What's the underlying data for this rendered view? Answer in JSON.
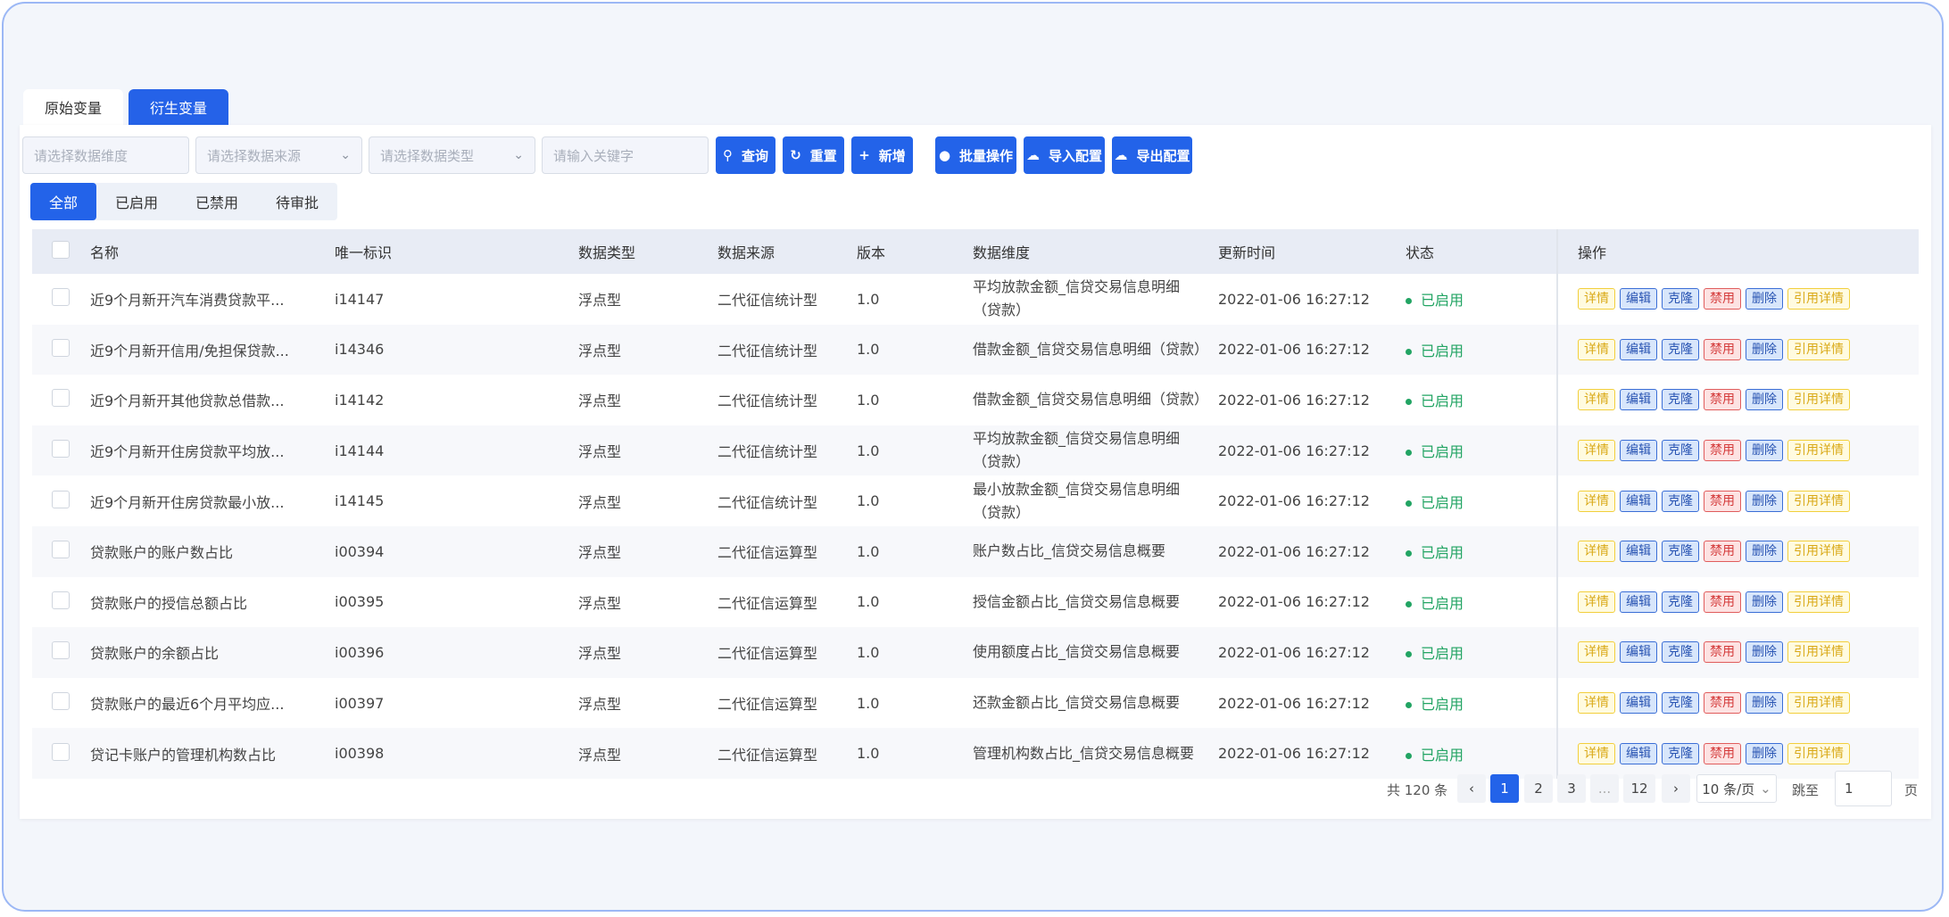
{
  "tabs": [
    {
      "label": "原始变量",
      "active": false
    },
    {
      "label": "衍生变量",
      "active": true
    }
  ],
  "filters": {
    "dimension_placeholder": "请选择数据维度",
    "source_placeholder": "请选择数据来源",
    "type_placeholder": "请选择数据类型",
    "keyword_placeholder": "请输入关键字"
  },
  "buttons": {
    "query": "查询",
    "reset": "重置",
    "add": "新增",
    "batch": "批量操作",
    "import": "导入配置",
    "export": "导出配置"
  },
  "status_tabs": [
    "全部",
    "已启用",
    "已禁用",
    "待审批"
  ],
  "table": {
    "headers": [
      "名称",
      "唯一标识",
      "数据类型",
      "数据来源",
      "版本",
      "数据维度",
      "更新时间",
      "状态",
      "操作"
    ],
    "rows": [
      {
        "name": "近9个月新开汽车消费贷款平...",
        "id": "i14147",
        "type": "浮点型",
        "source": "二代征信统计型",
        "version": "1.0",
        "dimension": "平均放款金额_信贷交易信息明细（贷款）",
        "time": "2022-01-06 16:27:12",
        "status": "已启用"
      },
      {
        "name": "近9个月新开信用/免担保贷款...",
        "id": "i14346",
        "type": "浮点型",
        "source": "二代征信统计型",
        "version": "1.0",
        "dimension": "借款金额_信贷交易信息明细（贷款）",
        "time": "2022-01-06 16:27:12",
        "status": "已启用"
      },
      {
        "name": "近9个月新开其他贷款总借款...",
        "id": "i14142",
        "type": "浮点型",
        "source": "二代征信统计型",
        "version": "1.0",
        "dimension": "借款金额_信贷交易信息明细（贷款）",
        "time": "2022-01-06 16:27:12",
        "status": "已启用"
      },
      {
        "name": "近9个月新开住房贷款平均放...",
        "id": "i14144",
        "type": "浮点型",
        "source": "二代征信统计型",
        "version": "1.0",
        "dimension": "平均放款金额_信贷交易信息明细（贷款）",
        "time": "2022-01-06 16:27:12",
        "status": "已启用"
      },
      {
        "name": "近9个月新开住房贷款最小放...",
        "id": "i14145",
        "type": "浮点型",
        "source": "二代征信统计型",
        "version": "1.0",
        "dimension": "最小放款金额_信贷交易信息明细（贷款）",
        "time": "2022-01-06 16:27:12",
        "status": "已启用"
      },
      {
        "name": "贷款账户的账户数占比",
        "id": "i00394",
        "type": "浮点型",
        "source": "二代征信运算型",
        "version": "1.0",
        "dimension": "账户数占比_信贷交易信息概要",
        "time": "2022-01-06 16:27:12",
        "status": "已启用"
      },
      {
        "name": "贷款账户的授信总额占比",
        "id": "i00395",
        "type": "浮点型",
        "source": "二代征信运算型",
        "version": "1.0",
        "dimension": "授信金额占比_信贷交易信息概要",
        "time": "2022-01-06 16:27:12",
        "status": "已启用"
      },
      {
        "name": "贷款账户的余额占比",
        "id": "i00396",
        "type": "浮点型",
        "source": "二代征信运算型",
        "version": "1.0",
        "dimension": "使用额度占比_信贷交易信息概要",
        "time": "2022-01-06 16:27:12",
        "status": "已启用"
      },
      {
        "name": "贷款账户的最近6个月平均应...",
        "id": "i00397",
        "type": "浮点型",
        "source": "二代征信运算型",
        "version": "1.0",
        "dimension": "还款金额占比_信贷交易信息概要",
        "time": "2022-01-06 16:27:12",
        "status": "已启用"
      },
      {
        "name": "贷记卡账户的管理机构数占比",
        "id": "i00398",
        "type": "浮点型",
        "source": "二代征信运算型",
        "version": "1.0",
        "dimension": "管理机构数占比_信贷交易信息概要",
        "time": "2022-01-06 16:27:12",
        "status": "已启用"
      }
    ],
    "actions": [
      {
        "label": "详情",
        "style": "y"
      },
      {
        "label": "编辑",
        "style": "b"
      },
      {
        "label": "克隆",
        "style": "b"
      },
      {
        "label": "禁用",
        "style": "r"
      },
      {
        "label": "删除",
        "style": "b"
      },
      {
        "label": "引用详情",
        "style": "y"
      }
    ]
  },
  "pagination": {
    "total": "共 120 条",
    "prev": "‹",
    "pages": [
      "1",
      "2",
      "3",
      "...",
      "12"
    ],
    "current": "1",
    "next": "›",
    "page_size": "10 条/页",
    "jump_label": "跳至",
    "jump_value": "1",
    "page_suffix": "页"
  },
  "colors": {
    "accent": "#2363e9",
    "status_ok": "#22a463",
    "frame_border": "#9cb8f5"
  }
}
